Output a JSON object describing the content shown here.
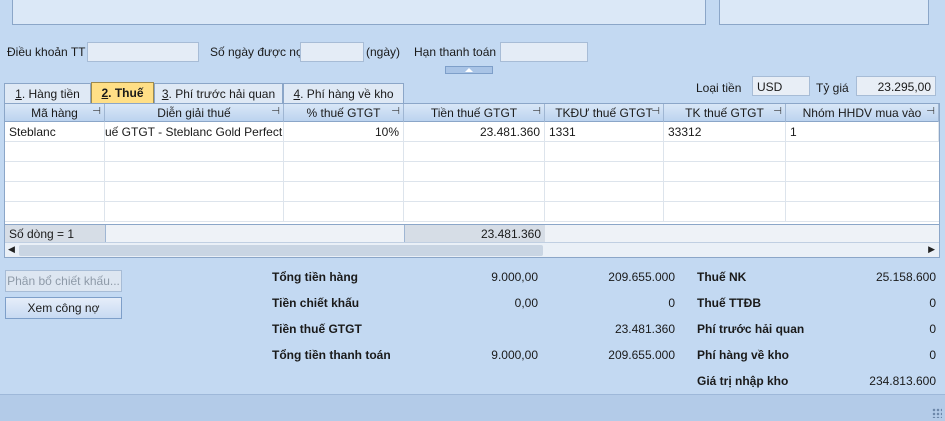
{
  "form": {
    "dieu_khoan_label": "Điều khoản TT",
    "dieu_khoan_value": "",
    "so_ngay_label": "Số ngày được nợ",
    "so_ngay_value": "",
    "ngay_unit": "(ngày)",
    "han_tt_label": "Hạn thanh toán",
    "han_tt_value": "",
    "loai_tien_label": "Loại tiền",
    "loai_tien_value": "USD",
    "ty_gia_label": "Tỷ giá",
    "ty_gia_value": "23.295,00"
  },
  "tabs": [
    {
      "key": "1",
      "rest": ". Hàng tiền",
      "active": false
    },
    {
      "key": "2",
      "rest": ". Thuế",
      "active": true
    },
    {
      "key": "3",
      "rest": ". Phí trước hải quan",
      "active": false
    },
    {
      "key": "4",
      "rest": ". Phí hàng về kho",
      "active": false
    }
  ],
  "grid": {
    "columns": [
      "Mã hàng",
      "Diễn giải thuế",
      "% thuế GTGT",
      "Tiền thuế GTGT",
      "TKĐƯ thuế GTGT",
      "TK thuế GTGT",
      "Nhóm HHDV mua vào"
    ],
    "rows": [
      [
        "Steblanc",
        "uế GTGT - Steblanc Gold Perfectio",
        "10%",
        "23.481.360",
        "1331",
        "33312",
        "1"
      ]
    ],
    "footer_count": "Số dòng = 1",
    "footer_total": "23.481.360"
  },
  "buttons": {
    "phan_bo": "Phân bổ chiết khấu...",
    "xem_cong_no": "Xem công nợ"
  },
  "summary": {
    "tong_tien_hang_label": "Tổng tiền hàng",
    "tong_tien_hang_usd": "9.000,00",
    "tong_tien_hang_vnd": "209.655.000",
    "tien_chiet_khau_label": "Tiền chiết khấu",
    "tien_chiet_khau_usd": "0,00",
    "tien_chiet_khau_vnd": "0",
    "tien_thue_gtgt_label": "Tiền thuế GTGT",
    "tien_thue_gtgt_vnd": "23.481.360",
    "tong_tt_label": "Tổng tiền thanh toán",
    "tong_tt_usd": "9.000,00",
    "tong_tt_vnd": "209.655.000",
    "thue_nk_label": "Thuế NK",
    "thue_nk_value": "25.158.600",
    "thue_ttdb_label": "Thuế TTĐB",
    "thue_ttdb_value": "0",
    "phi_truoc_hq_label": "Phí trước hải quan",
    "phi_truoc_hq_value": "0",
    "phi_ve_kho_label": "Phí hàng về kho",
    "phi_ve_kho_value": "0",
    "gia_tri_nk_label": "Giá trị nhập kho",
    "gia_tri_nk_value": "234.813.600"
  },
  "icons": {
    "column_pin": "pin-icon",
    "expand": "chevron-up-icon",
    "scroll_left": "arrow-left-icon",
    "scroll_right": "arrow-right-icon"
  }
}
